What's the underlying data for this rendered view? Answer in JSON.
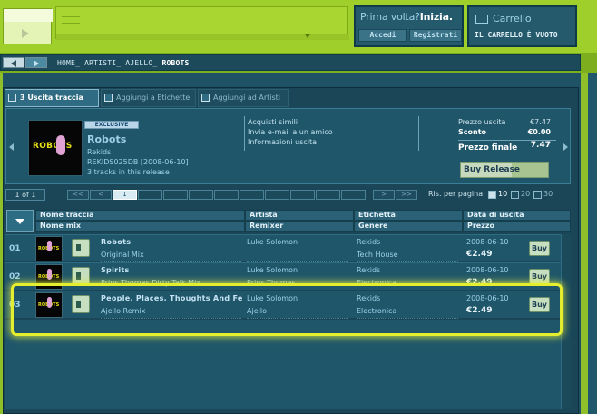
{
  "login": {
    "title_q": "Prima volta?",
    "title_a": "Inizia.",
    "accedi": "Accedi",
    "registrati": "Registrati"
  },
  "cart": {
    "title": "Carrello",
    "status": "IL CARRELLO È VUOTO"
  },
  "breadcrumb": {
    "home": "HOME_",
    "artisti": "ARTISTI_",
    "ajello": "AJELLO_",
    "current": "ROBOTS"
  },
  "tabs": [
    {
      "label": "3 Uscita traccia"
    },
    {
      "label": "Aggiungi a Etichette"
    },
    {
      "label": "Aggiungi ad Artisti"
    }
  ],
  "release": {
    "badge": "EXCLUSIVE",
    "cover_text": "ROBOTS",
    "title": "Robots",
    "label": "Rekids",
    "catalog": "REKIDS025DB [2008-06-10]",
    "tracks": "3 tracks in this release"
  },
  "links": [
    "Acquisti simili",
    "Invia e-mail a un amico",
    "Informazioni uscita"
  ],
  "prices": {
    "prezzo_label": "Prezzo uscita",
    "prezzo_value": "€7.47",
    "sconto_label": "Sconto",
    "sconto_value": "€0.00",
    "finale_label": "Prezzo finale",
    "finale_value": "7.47",
    "buy_release": "Buy Release"
  },
  "pager": {
    "count": "1 of 1",
    "first": "<<",
    "prev": "<",
    "page": "1",
    "next": ">",
    "last": ">>",
    "per_page_label": "Ris. per pagina",
    "opt10": "10",
    "opt20": "20",
    "opt30": "30"
  },
  "headers": {
    "nome_traccia": "Nome traccia",
    "nome_mix": "Nome mix",
    "artista": "Artista",
    "remixer": "Remixer",
    "etichetta": "Etichetta",
    "genere": "Genere",
    "data": "Data di uscita",
    "prezzo": "Prezzo"
  },
  "rows": [
    {
      "num": "01",
      "title": "Robots",
      "mix": "Original Mix",
      "artist": "Luke Solomon",
      "remixer": "",
      "label": "Rekids",
      "genre": "Tech House",
      "date": "2008-06-10",
      "price": "€2.49",
      "buy": "Buy"
    },
    {
      "num": "02",
      "title": "Spirits",
      "mix": "Prins Thomas Dirty Talk Mix",
      "artist": "Luke Solomon",
      "remixer": "Prins Thomas",
      "label": "Rekids",
      "genre": "Electronica",
      "date": "2008-06-10",
      "price": "€2.49",
      "buy": "Buy"
    },
    {
      "num": "03",
      "title": "People, Places, Thoughts And Fe",
      "mix": "Ajello Remix",
      "artist": "Luke Solomon",
      "remixer": "Ajello",
      "label": "Rekids",
      "genre": "Electronica",
      "date": "2008-06-10",
      "price": "€2.49",
      "buy": "Buy"
    }
  ],
  "colors": {
    "highlight": "#e5ee2e",
    "brand_green": "#9fcf2a",
    "panel": "#1f566a"
  }
}
